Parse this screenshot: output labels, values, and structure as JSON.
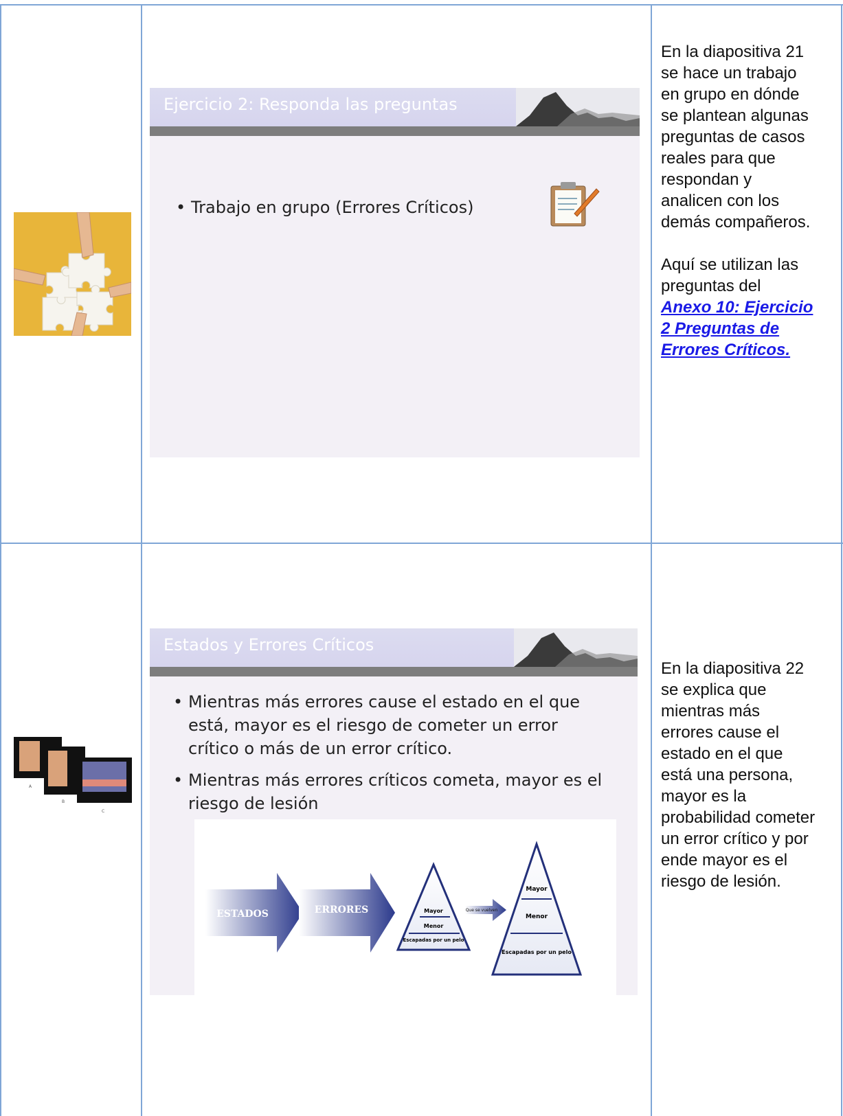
{
  "row1": {
    "thumbnail_icon": "puzzle-hands-photo",
    "slide": {
      "title": "Ejercicio 2: Responda las preguntas",
      "bullet": "Trabajo en grupo  (Errores Críticos)",
      "icon": "clipboard-icon"
    },
    "notes": {
      "para1": "En la diapositiva 21 se hace un trabajo en grupo en dónde se plantean algunas preguntas de casos reales para que respondan y analicen con los demás compañeros.",
      "para2_text": "Aquí se utilizan las preguntas del ",
      "link": "Anexo 10: Ejercicio 2 Preguntas de Errores Críticos."
    }
  },
  "row2": {
    "thumbnail_icon": "slides-thumbnail",
    "slide": {
      "title": "Estados y Errores Críticos",
      "bullets": [
        "Mientras más errores cause el estado en el que está, mayor es el riesgo de cometer un error crítico o más de un error crítico.",
        "Mientras más errores críticos cometa, mayor es el riesgo de lesión"
      ],
      "diagram": {
        "arrow1": "ESTADOS",
        "arrow2": "ERRORES",
        "small_arrow": "Que se vuelven",
        "pyramid1": [
          "Mayor",
          "Menor",
          "Escapadas por un pelo"
        ],
        "pyramid2": [
          "Mayor",
          "Menor",
          "Escapadas por un pelo"
        ]
      }
    },
    "notes": {
      "para1": "En la diapositiva 22 se explica que mientras más errores cause el estado en el que está una persona, mayor es la probabilidad cometer un error crítico y por ende mayor es el riesgo de lesión."
    }
  },
  "colors": {
    "border": "#7fa6d6",
    "link": "#1a1ae6",
    "slide_bg": "#f3f0f6"
  }
}
